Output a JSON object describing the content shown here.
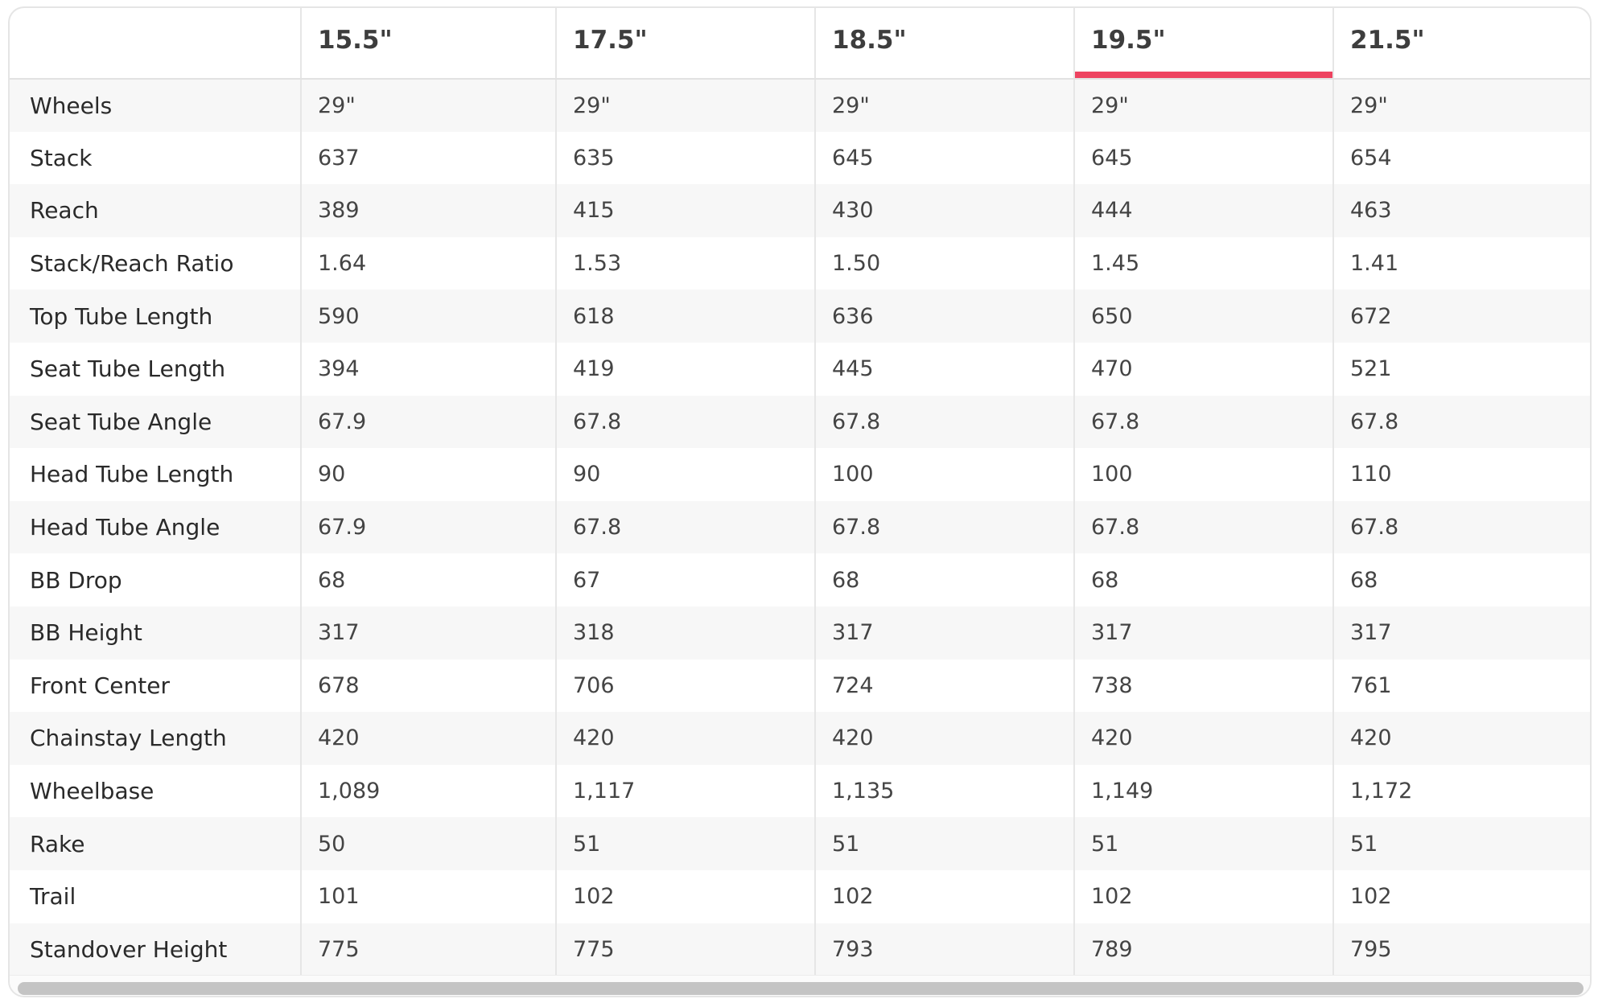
{
  "table": {
    "corner_label": "",
    "columns": [
      "15.5\"",
      "17.5\"",
      "18.5\"",
      "19.5\"",
      "21.5\""
    ],
    "active_column_index": 3,
    "accent_color": "#ee4360",
    "rows": [
      {
        "label": "Wheels",
        "values": [
          "29\"",
          "29\"",
          "29\"",
          "29\"",
          "29\""
        ]
      },
      {
        "label": "Stack",
        "values": [
          "637",
          "635",
          "645",
          "645",
          "654"
        ]
      },
      {
        "label": "Reach",
        "values": [
          "389",
          "415",
          "430",
          "444",
          "463"
        ]
      },
      {
        "label": "Stack/Reach Ratio",
        "values": [
          "1.64",
          "1.53",
          "1.50",
          "1.45",
          "1.41"
        ]
      },
      {
        "label": "Top Tube Length",
        "values": [
          "590",
          "618",
          "636",
          "650",
          "672"
        ]
      },
      {
        "label": "Seat Tube Length",
        "values": [
          "394",
          "419",
          "445",
          "470",
          "521"
        ]
      },
      {
        "label": "Seat Tube Angle",
        "values": [
          "67.9",
          "67.8",
          "67.8",
          "67.8",
          "67.8"
        ]
      },
      {
        "label": "Head Tube Length",
        "values": [
          "90",
          "90",
          "100",
          "100",
          "110"
        ]
      },
      {
        "label": "Head Tube Angle",
        "values": [
          "67.9",
          "67.8",
          "67.8",
          "67.8",
          "67.8"
        ]
      },
      {
        "label": "BB Drop",
        "values": [
          "68",
          "67",
          "68",
          "68",
          "68"
        ]
      },
      {
        "label": "BB Height",
        "values": [
          "317",
          "318",
          "317",
          "317",
          "317"
        ]
      },
      {
        "label": "Front Center",
        "values": [
          "678",
          "706",
          "724",
          "738",
          "761"
        ]
      },
      {
        "label": "Chainstay Length",
        "values": [
          "420",
          "420",
          "420",
          "420",
          "420"
        ]
      },
      {
        "label": "Wheelbase",
        "values": [
          "1,089",
          "1,117",
          "1,135",
          "1,149",
          "1,172"
        ]
      },
      {
        "label": "Rake",
        "values": [
          "50",
          "51",
          "51",
          "51",
          "51"
        ]
      },
      {
        "label": "Trail",
        "values": [
          "101",
          "102",
          "102",
          "102",
          "102"
        ]
      },
      {
        "label": "Standover Height",
        "values": [
          "775",
          "775",
          "793",
          "789",
          "795"
        ]
      }
    ]
  }
}
